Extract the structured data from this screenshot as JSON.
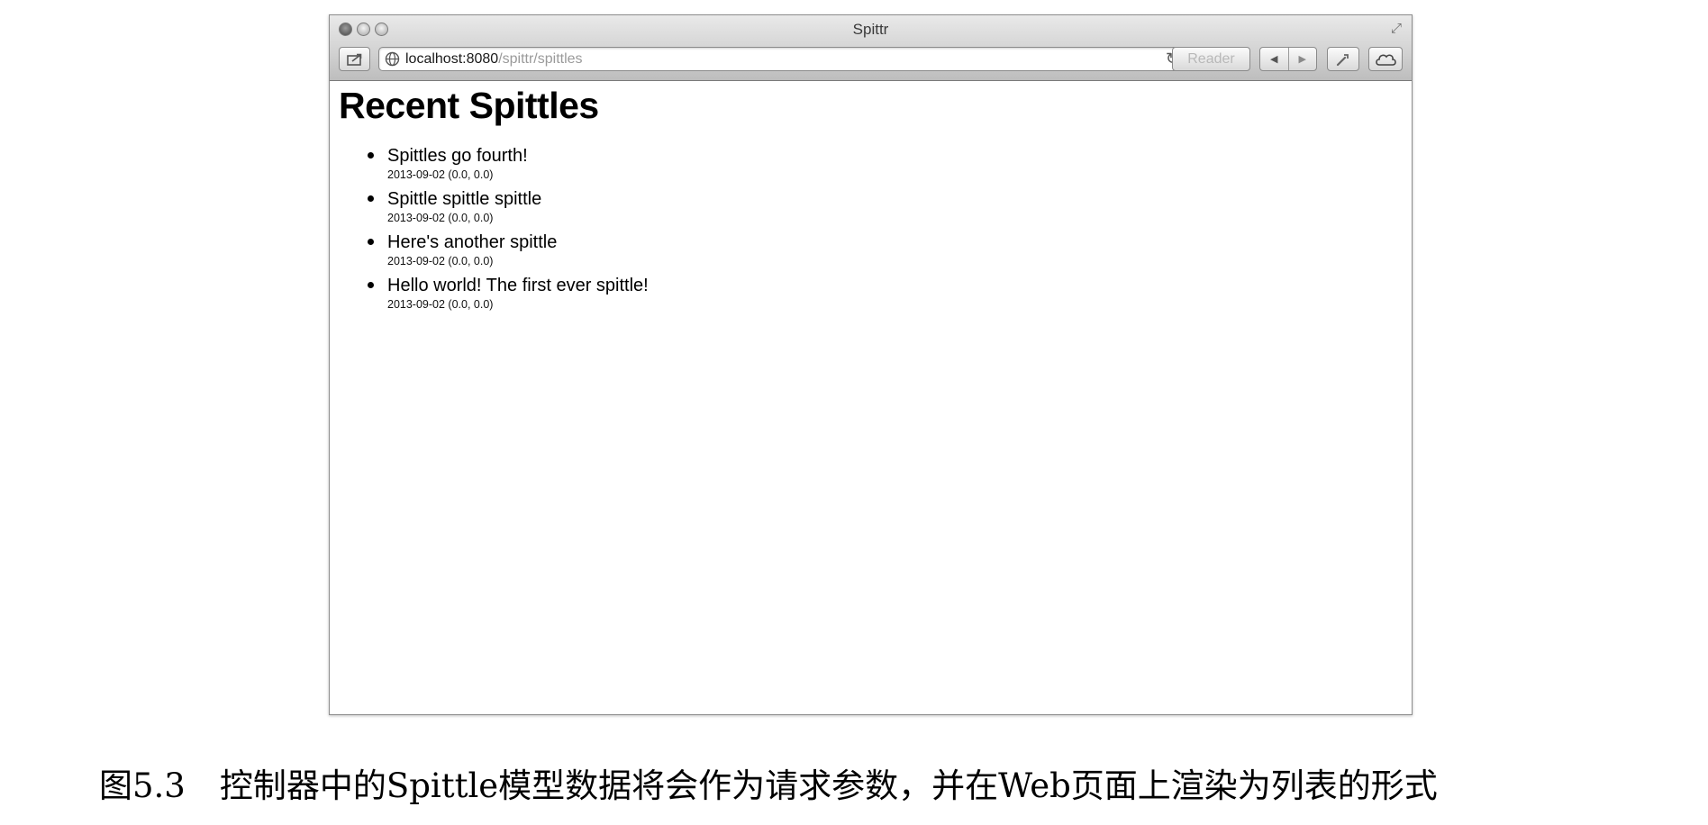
{
  "window": {
    "title": "Spittr",
    "url_host": "localhost:8080",
    "url_path": "/spittr/spittles",
    "reader_label": "Reader"
  },
  "page": {
    "heading": "Recent Spittles",
    "spittles": [
      {
        "message": "Spittles go fourth!",
        "meta": "2013-09-02 (0.0, 0.0)"
      },
      {
        "message": "Spittle spittle spittle",
        "meta": "2013-09-02 (0.0, 0.0)"
      },
      {
        "message": "Here's another spittle",
        "meta": "2013-09-02 (0.0, 0.0)"
      },
      {
        "message": "Hello world! The first ever spittle!",
        "meta": "2013-09-02 (0.0, 0.0)"
      }
    ]
  },
  "caption": {
    "figure_number": "图5.3",
    "text": "控制器中的Spittle模型数据将会作为请求参数，并在Web页面上渲染为列表的形式"
  },
  "icons": {
    "share": "share-icon",
    "globe": "globe-icon",
    "reload": "reload-icon",
    "back": "back-arrow-icon",
    "forward": "forward-arrow-icon",
    "tools": "wrench-icon",
    "cloud": "cloud-icon",
    "fullscreen": "fullscreen-icon"
  }
}
